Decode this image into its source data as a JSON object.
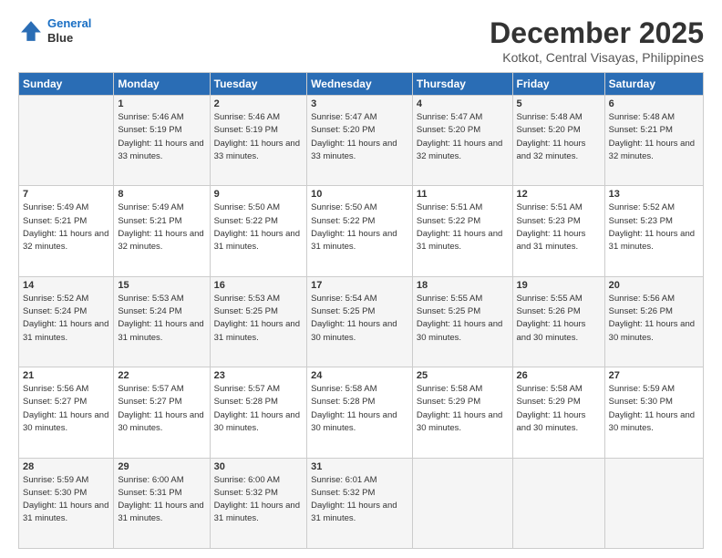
{
  "logo": {
    "line1": "General",
    "line2": "Blue"
  },
  "title": "December 2025",
  "subtitle": "Kotkot, Central Visayas, Philippines",
  "days_header": [
    "Sunday",
    "Monday",
    "Tuesday",
    "Wednesday",
    "Thursday",
    "Friday",
    "Saturday"
  ],
  "weeks": [
    [
      {
        "num": "",
        "sunrise": "",
        "sunset": "",
        "daylight": ""
      },
      {
        "num": "1",
        "sunrise": "Sunrise: 5:46 AM",
        "sunset": "Sunset: 5:19 PM",
        "daylight": "Daylight: 11 hours and 33 minutes."
      },
      {
        "num": "2",
        "sunrise": "Sunrise: 5:46 AM",
        "sunset": "Sunset: 5:19 PM",
        "daylight": "Daylight: 11 hours and 33 minutes."
      },
      {
        "num": "3",
        "sunrise": "Sunrise: 5:47 AM",
        "sunset": "Sunset: 5:20 PM",
        "daylight": "Daylight: 11 hours and 33 minutes."
      },
      {
        "num": "4",
        "sunrise": "Sunrise: 5:47 AM",
        "sunset": "Sunset: 5:20 PM",
        "daylight": "Daylight: 11 hours and 32 minutes."
      },
      {
        "num": "5",
        "sunrise": "Sunrise: 5:48 AM",
        "sunset": "Sunset: 5:20 PM",
        "daylight": "Daylight: 11 hours and 32 minutes."
      },
      {
        "num": "6",
        "sunrise": "Sunrise: 5:48 AM",
        "sunset": "Sunset: 5:21 PM",
        "daylight": "Daylight: 11 hours and 32 minutes."
      }
    ],
    [
      {
        "num": "7",
        "sunrise": "Sunrise: 5:49 AM",
        "sunset": "Sunset: 5:21 PM",
        "daylight": "Daylight: 11 hours and 32 minutes."
      },
      {
        "num": "8",
        "sunrise": "Sunrise: 5:49 AM",
        "sunset": "Sunset: 5:21 PM",
        "daylight": "Daylight: 11 hours and 32 minutes."
      },
      {
        "num": "9",
        "sunrise": "Sunrise: 5:50 AM",
        "sunset": "Sunset: 5:22 PM",
        "daylight": "Daylight: 11 hours and 31 minutes."
      },
      {
        "num": "10",
        "sunrise": "Sunrise: 5:50 AM",
        "sunset": "Sunset: 5:22 PM",
        "daylight": "Daylight: 11 hours and 31 minutes."
      },
      {
        "num": "11",
        "sunrise": "Sunrise: 5:51 AM",
        "sunset": "Sunset: 5:22 PM",
        "daylight": "Daylight: 11 hours and 31 minutes."
      },
      {
        "num": "12",
        "sunrise": "Sunrise: 5:51 AM",
        "sunset": "Sunset: 5:23 PM",
        "daylight": "Daylight: 11 hours and 31 minutes."
      },
      {
        "num": "13",
        "sunrise": "Sunrise: 5:52 AM",
        "sunset": "Sunset: 5:23 PM",
        "daylight": "Daylight: 11 hours and 31 minutes."
      }
    ],
    [
      {
        "num": "14",
        "sunrise": "Sunrise: 5:52 AM",
        "sunset": "Sunset: 5:24 PM",
        "daylight": "Daylight: 11 hours and 31 minutes."
      },
      {
        "num": "15",
        "sunrise": "Sunrise: 5:53 AM",
        "sunset": "Sunset: 5:24 PM",
        "daylight": "Daylight: 11 hours and 31 minutes."
      },
      {
        "num": "16",
        "sunrise": "Sunrise: 5:53 AM",
        "sunset": "Sunset: 5:25 PM",
        "daylight": "Daylight: 11 hours and 31 minutes."
      },
      {
        "num": "17",
        "sunrise": "Sunrise: 5:54 AM",
        "sunset": "Sunset: 5:25 PM",
        "daylight": "Daylight: 11 hours and 30 minutes."
      },
      {
        "num": "18",
        "sunrise": "Sunrise: 5:55 AM",
        "sunset": "Sunset: 5:25 PM",
        "daylight": "Daylight: 11 hours and 30 minutes."
      },
      {
        "num": "19",
        "sunrise": "Sunrise: 5:55 AM",
        "sunset": "Sunset: 5:26 PM",
        "daylight": "Daylight: 11 hours and 30 minutes."
      },
      {
        "num": "20",
        "sunrise": "Sunrise: 5:56 AM",
        "sunset": "Sunset: 5:26 PM",
        "daylight": "Daylight: 11 hours and 30 minutes."
      }
    ],
    [
      {
        "num": "21",
        "sunrise": "Sunrise: 5:56 AM",
        "sunset": "Sunset: 5:27 PM",
        "daylight": "Daylight: 11 hours and 30 minutes."
      },
      {
        "num": "22",
        "sunrise": "Sunrise: 5:57 AM",
        "sunset": "Sunset: 5:27 PM",
        "daylight": "Daylight: 11 hours and 30 minutes."
      },
      {
        "num": "23",
        "sunrise": "Sunrise: 5:57 AM",
        "sunset": "Sunset: 5:28 PM",
        "daylight": "Daylight: 11 hours and 30 minutes."
      },
      {
        "num": "24",
        "sunrise": "Sunrise: 5:58 AM",
        "sunset": "Sunset: 5:28 PM",
        "daylight": "Daylight: 11 hours and 30 minutes."
      },
      {
        "num": "25",
        "sunrise": "Sunrise: 5:58 AM",
        "sunset": "Sunset: 5:29 PM",
        "daylight": "Daylight: 11 hours and 30 minutes."
      },
      {
        "num": "26",
        "sunrise": "Sunrise: 5:58 AM",
        "sunset": "Sunset: 5:29 PM",
        "daylight": "Daylight: 11 hours and 30 minutes."
      },
      {
        "num": "27",
        "sunrise": "Sunrise: 5:59 AM",
        "sunset": "Sunset: 5:30 PM",
        "daylight": "Daylight: 11 hours and 30 minutes."
      }
    ],
    [
      {
        "num": "28",
        "sunrise": "Sunrise: 5:59 AM",
        "sunset": "Sunset: 5:30 PM",
        "daylight": "Daylight: 11 hours and 31 minutes."
      },
      {
        "num": "29",
        "sunrise": "Sunrise: 6:00 AM",
        "sunset": "Sunset: 5:31 PM",
        "daylight": "Daylight: 11 hours and 31 minutes."
      },
      {
        "num": "30",
        "sunrise": "Sunrise: 6:00 AM",
        "sunset": "Sunset: 5:32 PM",
        "daylight": "Daylight: 11 hours and 31 minutes."
      },
      {
        "num": "31",
        "sunrise": "Sunrise: 6:01 AM",
        "sunset": "Sunset: 5:32 PM",
        "daylight": "Daylight: 11 hours and 31 minutes."
      },
      {
        "num": "",
        "sunrise": "",
        "sunset": "",
        "daylight": ""
      },
      {
        "num": "",
        "sunrise": "",
        "sunset": "",
        "daylight": ""
      },
      {
        "num": "",
        "sunrise": "",
        "sunset": "",
        "daylight": ""
      }
    ]
  ]
}
